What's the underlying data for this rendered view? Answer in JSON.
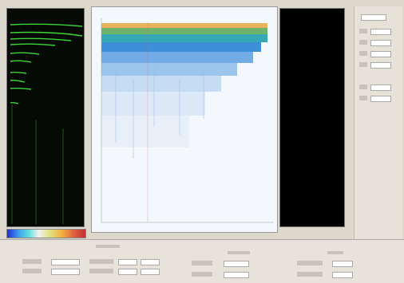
{
  "note": "",
  "panels": {
    "left_spectrum": {
      "label": ""
    },
    "waterfall": {
      "label": ""
    },
    "right_panel": {
      "label": ""
    }
  },
  "bottom": {
    "group_labels": [
      "",
      "",
      ""
    ]
  },
  "colors": {
    "spectrum_trace": "#3fe03a",
    "left_bg": "#050a05",
    "waterfall_bg": "#f4f7fb",
    "right_bg": "#000000",
    "ui_bg": "#ddd8cc"
  }
}
